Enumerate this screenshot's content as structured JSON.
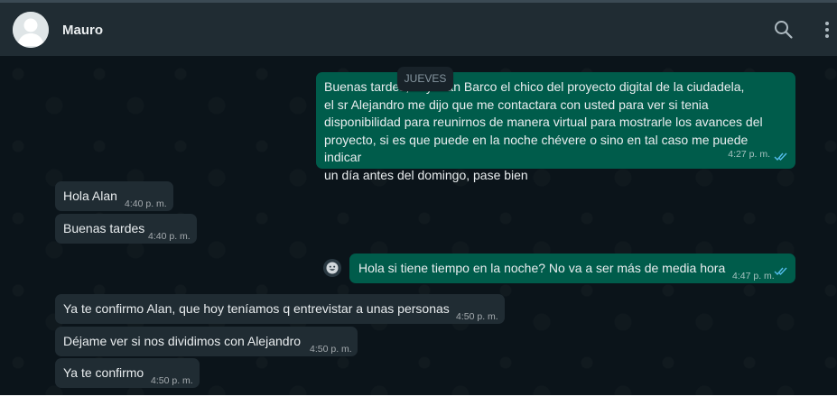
{
  "header": {
    "contact_name": "Mauro",
    "avatar_icon": "default-user-avatar",
    "search_icon": "search-icon",
    "menu_icon": "vertical-dots-icon"
  },
  "day_separator": "JUEVES",
  "messages": [
    {
      "direction": "outgoing",
      "lines": [
        "Buenas tardes, soy Alan Barco el chico del proyecto digital de la ciudadela,",
        "el sr Alejandro me dijo que me contactara con usted para ver si tenia",
        "disponibilidad para reunirnos de manera virtual para mostrarle los avances del",
        "proyecto, si es que puede en la noche chévere o sino en tal caso me puede indicar",
        "un día antes del domingo, pase bien"
      ],
      "time": "4:27 p. m.",
      "status": "read"
    },
    {
      "direction": "incoming",
      "text": "Hola Alan",
      "time": "4:40 p. m."
    },
    {
      "direction": "incoming",
      "text": "Buenas tardes",
      "time": "4:40 p. m."
    },
    {
      "direction": "outgoing",
      "text": "Hola si tiene tiempo en la noche? No va a ser más de media hora",
      "time": "4:47 p. m.",
      "status": "read"
    },
    {
      "direction": "incoming",
      "text": "Ya te confirmo Alan, que hoy teníamos q entrevistar a unas personas",
      "time": "4:50 p. m."
    },
    {
      "direction": "incoming",
      "text": "Déjame ver si nos dividimos con Alejandro",
      "time": "4:50 p. m."
    },
    {
      "direction": "incoming",
      "text": "Ya te confirmo",
      "time": "4:50 p. m."
    }
  ],
  "colors": {
    "chat_background": "#0b141a",
    "header_background": "#202c33",
    "outgoing_bubble": "#005c4b",
    "incoming_bubble": "#202c33",
    "read_ticks": "#53bdeb"
  }
}
